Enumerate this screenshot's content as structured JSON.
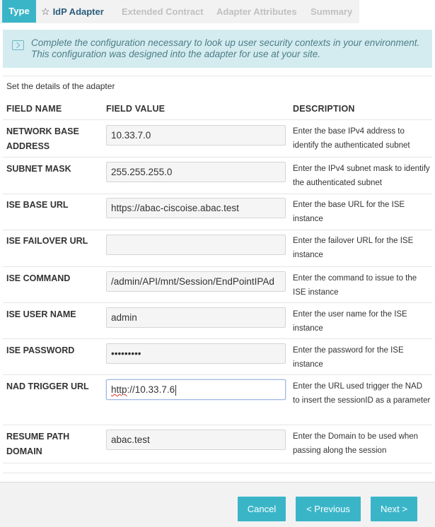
{
  "tabs": {
    "type": "Type",
    "idp": "IdP Adapter",
    "extended": "Extended Contract",
    "attributes": "Adapter Attributes",
    "summary": "Summary"
  },
  "banner": {
    "text": "Complete the configuration necessary to look up user security contexts in your environment. This configuration was designed into the adapter for use at your site."
  },
  "subtitle": "Set the details of the adapter",
  "table": {
    "headers": {
      "name": "FIELD NAME",
      "value": "FIELD VALUE",
      "description": "DESCRIPTION"
    },
    "rows": [
      {
        "name": "NETWORK BASE ADDRESS",
        "value": "10.33.7.0",
        "description": "Enter the base IPv4 address to identify the authenticated subnet"
      },
      {
        "name": "SUBNET MASK",
        "value": "255.255.255.0",
        "description": "Enter the IPv4 subnet mask to identify the authenticated subnet"
      },
      {
        "name": "ISE BASE URL",
        "value": "https://abac-ciscoise.abac.test",
        "description": "Enter the base URL for the ISE instance"
      },
      {
        "name": "ISE FAILOVER URL",
        "value": "",
        "description": "Enter the failover URL for the ISE instance"
      },
      {
        "name": "ISE COMMAND",
        "value": "/admin/API/mnt/Session/EndPointIPAd",
        "description": "Enter the command to issue to the ISE instance"
      },
      {
        "name": "ISE USER NAME",
        "value": "admin",
        "description": "Enter the user name for the ISE instance"
      },
      {
        "name": "ISE PASSWORD",
        "value": "•••••••••",
        "description": "Enter the password for the ISE instance"
      },
      {
        "name": "NAD TRIGGER URL",
        "value_prefix": "http",
        "value": "://10.33.7.6",
        "description": "Enter the URL used trigger the NAD to insert the sessionID as a parameter"
      },
      {
        "name": "RESUME PATH DOMAIN",
        "value": "abac.test",
        "description": "Enter the Domain to be used when passing along the session"
      }
    ]
  },
  "footer": {
    "cancel": "Cancel",
    "previous": "< Previous",
    "next": "Next >"
  }
}
